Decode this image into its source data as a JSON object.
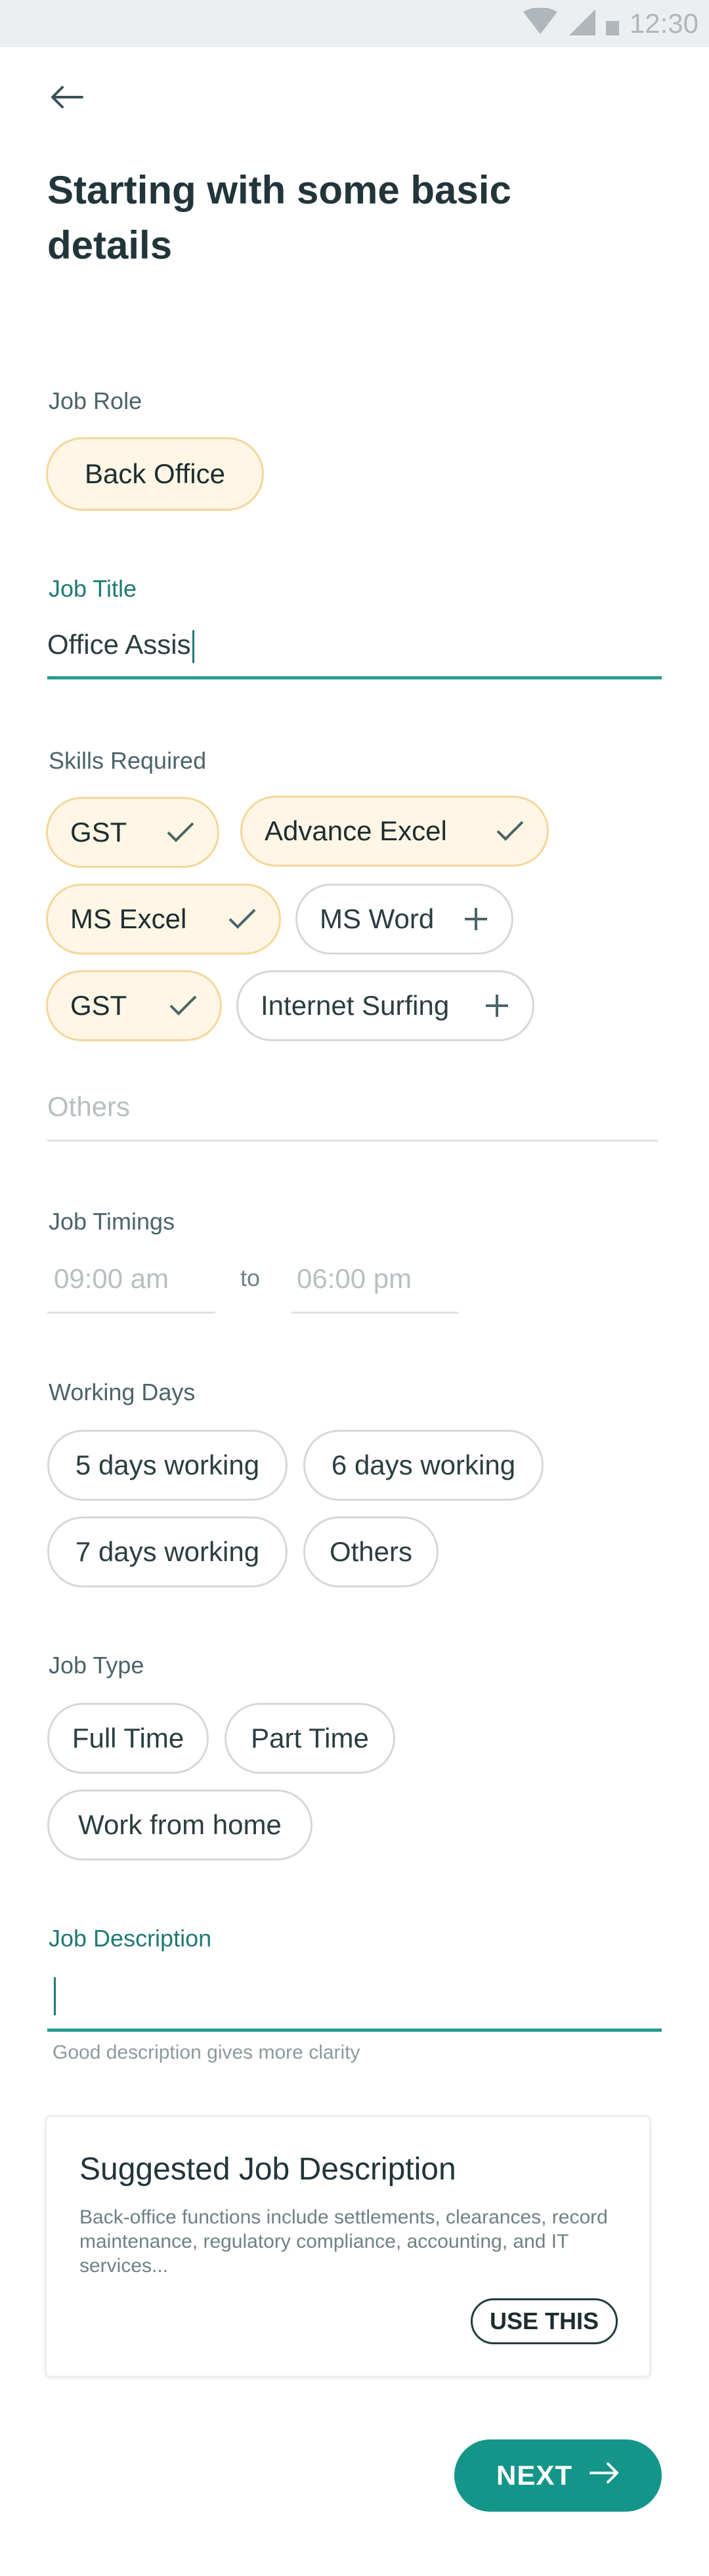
{
  "status_bar": {
    "time": "12:30",
    "icons": [
      "wifi-icon",
      "signal-icon",
      "battery-icon"
    ]
  },
  "header": {
    "title": "Starting with some basic details",
    "back_icon": "arrow-left-icon"
  },
  "job_role": {
    "label": "Job Role",
    "selected": "Back Office"
  },
  "job_title": {
    "label": "Job Title",
    "value": "Office Assis"
  },
  "skills": {
    "label": "Skills Required",
    "items": [
      {
        "label": "GST",
        "selected": true,
        "icon": "check-icon"
      },
      {
        "label": "Advance Excel",
        "selected": true,
        "icon": "check-icon"
      },
      {
        "label": "MS Excel",
        "selected": true,
        "icon": "check-icon"
      },
      {
        "label": "MS Word",
        "selected": false,
        "icon": "plus-icon"
      },
      {
        "label": "GST",
        "selected": true,
        "icon": "check-icon"
      },
      {
        "label": "Internet Surfing",
        "selected": false,
        "icon": "plus-icon"
      }
    ],
    "others_placeholder": "Others"
  },
  "job_timings": {
    "label": "Job Timings",
    "start_placeholder": "09:00 am",
    "separator": "to",
    "end_placeholder": "06:00 pm"
  },
  "working_days": {
    "label": "Working Days",
    "options": [
      "5 days working",
      "6 days working",
      "7 days working",
      "Others"
    ]
  },
  "job_type": {
    "label": "Job Type",
    "options": [
      "Full Time",
      "Part Time",
      "Work from home"
    ]
  },
  "job_description": {
    "label": "Job Description",
    "value": "",
    "helper": "Good description gives more clarity"
  },
  "suggestion": {
    "title": "Suggested Job Description",
    "body": "Back-office functions include settlements, clearances, record maintenance, regulatory compliance, accounting, and IT services...",
    "button": "USE THIS"
  },
  "next_button": {
    "label": "NEXT",
    "icon": "arrow-right-icon"
  },
  "colors": {
    "accent": "#149589",
    "selected_chip_bg": "#fff6e6",
    "selected_chip_border": "#f4d79a",
    "label_teal": "#1f7a72"
  }
}
